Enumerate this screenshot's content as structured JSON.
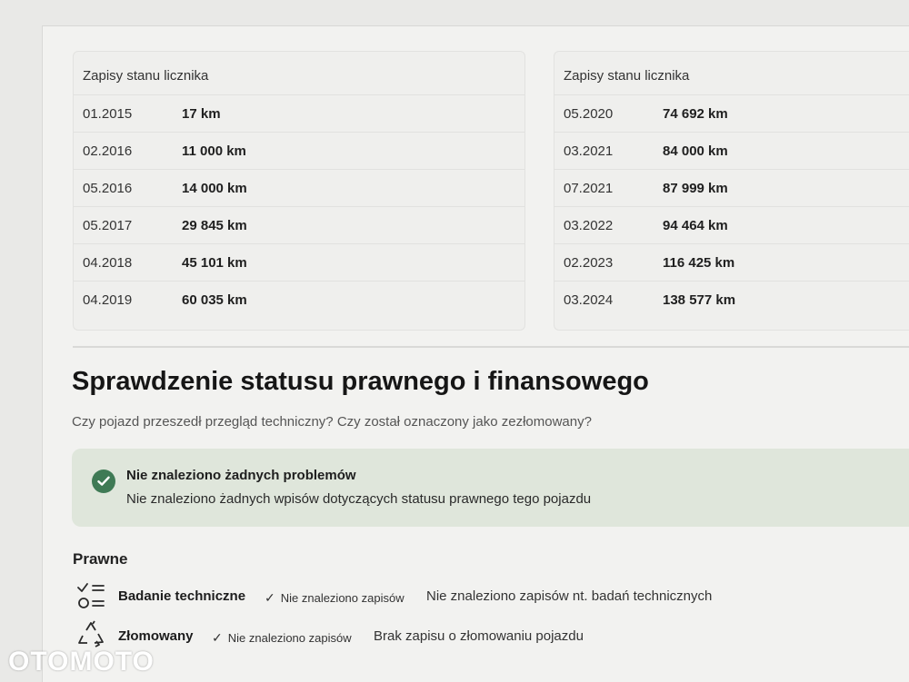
{
  "odometer_left": {
    "title": "Zapisy stanu licznika",
    "rows": [
      {
        "date": "01.2015",
        "km": "17 km"
      },
      {
        "date": "02.2016",
        "km": "11 000 km"
      },
      {
        "date": "05.2016",
        "km": "14 000 km"
      },
      {
        "date": "05.2017",
        "km": "29 845 km"
      },
      {
        "date": "04.2018",
        "km": "45 101 km"
      },
      {
        "date": "04.2019",
        "km": "60 035 km"
      }
    ]
  },
  "odometer_right": {
    "title": "Zapisy stanu licznika",
    "rows": [
      {
        "date": "05.2020",
        "km": "74 692 km"
      },
      {
        "date": "03.2021",
        "km": "84 000 km"
      },
      {
        "date": "07.2021",
        "km": "87 999 km"
      },
      {
        "date": "03.2022",
        "km": "94 464 km"
      },
      {
        "date": "02.2023",
        "km": "116 425 km"
      },
      {
        "date": "03.2024",
        "km": "138 577 km"
      }
    ]
  },
  "legal_section": {
    "title": "Sprawdzenie statusu prawnego i finansowego",
    "subtitle": "Czy pojazd przeszedł przegląd techniczny? Czy został oznaczony jako zezłomowany?",
    "alert": {
      "icon": "check-circle-icon",
      "title": "Nie znaleziono żadnych problemów",
      "text": "Nie znaleziono żadnych wpisów dotyczących statusu prawnego tego pojazdu",
      "color": "#3f7a55"
    },
    "subsection_title": "Prawne",
    "items": [
      {
        "icon": "checklist-icon",
        "name": "Badanie techniczne",
        "status": "Nie znaleziono zapisów",
        "description": "Nie znaleziono zapisów nt. badań technicznych"
      },
      {
        "icon": "recycle-icon",
        "name": "Złomowany",
        "status": "Nie znaleziono zapisów",
        "description": "Brak zapisu o złomowaniu pojazdu"
      }
    ]
  },
  "watermark": "OTOMOTO"
}
